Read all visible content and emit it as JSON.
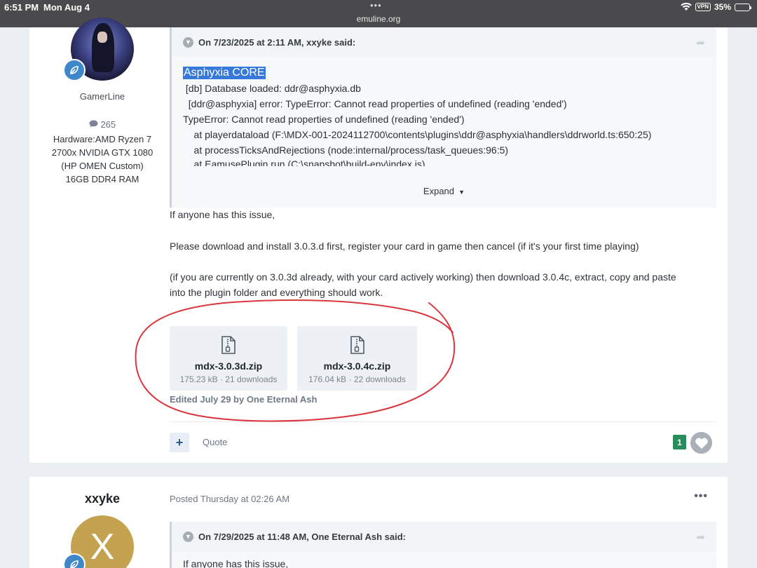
{
  "status_bar": {
    "time": "6:51 PM",
    "date": "Mon Aug 4",
    "dots": "•••",
    "url": "emuline.org",
    "vpn": "VPN",
    "battery": "35%",
    "battery_level": 0.35
  },
  "post1": {
    "author": "GamerLine",
    "post_count": "265",
    "signature": [
      "Hardware:AMD Ryzen 7",
      "2700x NVIDIA GTX 1080",
      "(HP OMEN Custom)",
      "16GB DDR4 RAM"
    ],
    "quote": {
      "header": "On 7/23/2025 at 2:11 AM, xxyke said:",
      "highlight": "Asphyxia CORE",
      "lines": [
        " [db] Database loaded: ddr@asphyxia.db",
        "  [ddr@asphyxia] error: TypeError: Cannot read properties of undefined (reading 'ended')",
        "TypeError: Cannot read properties of undefined (reading 'ended')",
        "    at playerdataload (F:\\MDX-001-2024112700\\contents\\plugins\\ddr@asphyxia\\handlers\\ddrworld.ts:650:25)",
        "    at processTicksAndRejections (node:internal/process/task_queues:96:5)",
        "    at EamusePlugin.run (C:\\snapshot\\build-env\\index.js)"
      ],
      "expand_label": "Expand"
    },
    "body": [
      "If anyone has this issue,",
      "Please download and install 3.0.3.d first, register your card in game then cancel (if it's your first time playing)",
      "(if you are currently on 3.0.3d already, with your card actively working) then download 3.0.4c, extract, copy and paste",
      "into the plugin folder and everything should work."
    ],
    "attachments": [
      {
        "name": "mdx-3.0.3d.zip",
        "meta": "175.23 kB · 21 downloads"
      },
      {
        "name": "mdx-3.0.4c.zip",
        "meta": "176.04 kB · 22 downloads"
      }
    ],
    "edited": "Edited July 29 by One Eternal Ash",
    "plus_label": "+",
    "quote_label": "Quote",
    "reaction_count": "1"
  },
  "post2": {
    "author": "xxyke",
    "avatar_letter": "X",
    "posted": "Posted Thursday at 02:26 AM",
    "more": "•••",
    "quote_header": "On 7/29/2025 at 11:48 AM, One Eternal Ash said:",
    "quote_preview": "If anyone has this issue,"
  },
  "colors": {
    "accent_blue": "#3f87c8",
    "highlight": "#3779d8",
    "reaction_green": "#2a8c5a",
    "annotation_red": "#d9363e"
  },
  "icons": [
    "wifi-icon",
    "chat-bubble-icon",
    "chevron-down-icon",
    "share-icon",
    "zip-file-icon",
    "heart-icon",
    "leaf-badge-icon"
  ]
}
